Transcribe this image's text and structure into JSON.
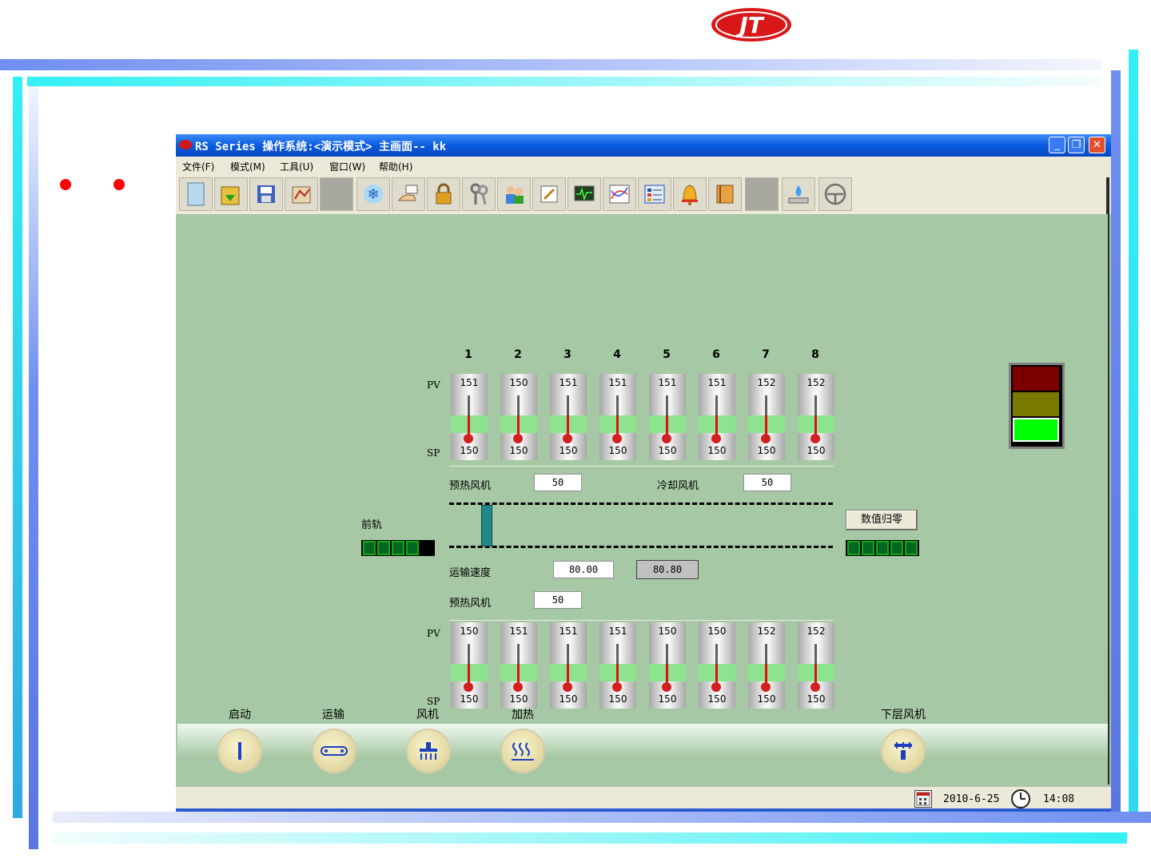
{
  "window": {
    "title": "RS Series 操作系统:<演示模式> 主画面-- kk",
    "buttons": [
      "_",
      "❐",
      "✕"
    ]
  },
  "menu": [
    {
      "label": "文件(F)"
    },
    {
      "label": "模式(M)"
    },
    {
      "label": "工具(U)"
    },
    {
      "label": "窗口(W)"
    },
    {
      "label": "帮助(H)"
    }
  ],
  "toolbar": {
    "icons": [
      "new-file",
      "open-folder",
      "save",
      "edit-chart",
      "blank",
      "snowflake",
      "hand-card",
      "lock",
      "keys",
      "users",
      "note-edit",
      "monitor-wave",
      "chart-lines",
      "list-panel",
      "alarm-bell",
      "notebook",
      "blank",
      "water-drop",
      "circle-logo"
    ]
  },
  "heater": {
    "zones": [
      "1",
      "2",
      "3",
      "4",
      "5",
      "6",
      "7",
      "8"
    ],
    "pv_label": "PV",
    "sp_label": "SP",
    "top_pv": [
      "151",
      "150",
      "151",
      "151",
      "151",
      "151",
      "152",
      "152"
    ],
    "top_sp": [
      "150",
      "150",
      "150",
      "150",
      "150",
      "150",
      "150",
      "150"
    ],
    "bottom_pv": [
      "150",
      "151",
      "151",
      "151",
      "150",
      "150",
      "152",
      "152"
    ],
    "bottom_sp": [
      "150",
      "150",
      "150",
      "150",
      "150",
      "150",
      "150",
      "150"
    ]
  },
  "fans": {
    "preheat_label": "预热风机",
    "preheat_value": "50",
    "cooling_label": "冷却风机",
    "cooling_value": "50",
    "preheat2_label": "预热风机",
    "preheat2_value": "50"
  },
  "conveyor": {
    "rail_label": "前轨",
    "zero_button": "数值归零",
    "speed_label": "运输速度",
    "speed_set": "80.00",
    "speed_actual": "80.80"
  },
  "signal_light": {
    "colors": [
      "#7a0000",
      "#7a7a00",
      "#00ff00"
    ]
  },
  "controls": [
    {
      "label": "启动",
      "icon": "power-icon"
    },
    {
      "label": "运输",
      "icon": "conveyor-icon"
    },
    {
      "label": "风机",
      "icon": "fan-icon"
    },
    {
      "label": "加热",
      "icon": "heat-icon"
    },
    {
      "label": "下层风机",
      "icon": "lower-fan-icon"
    }
  ],
  "status": {
    "date": "2010-6-25",
    "time": "14:08"
  }
}
